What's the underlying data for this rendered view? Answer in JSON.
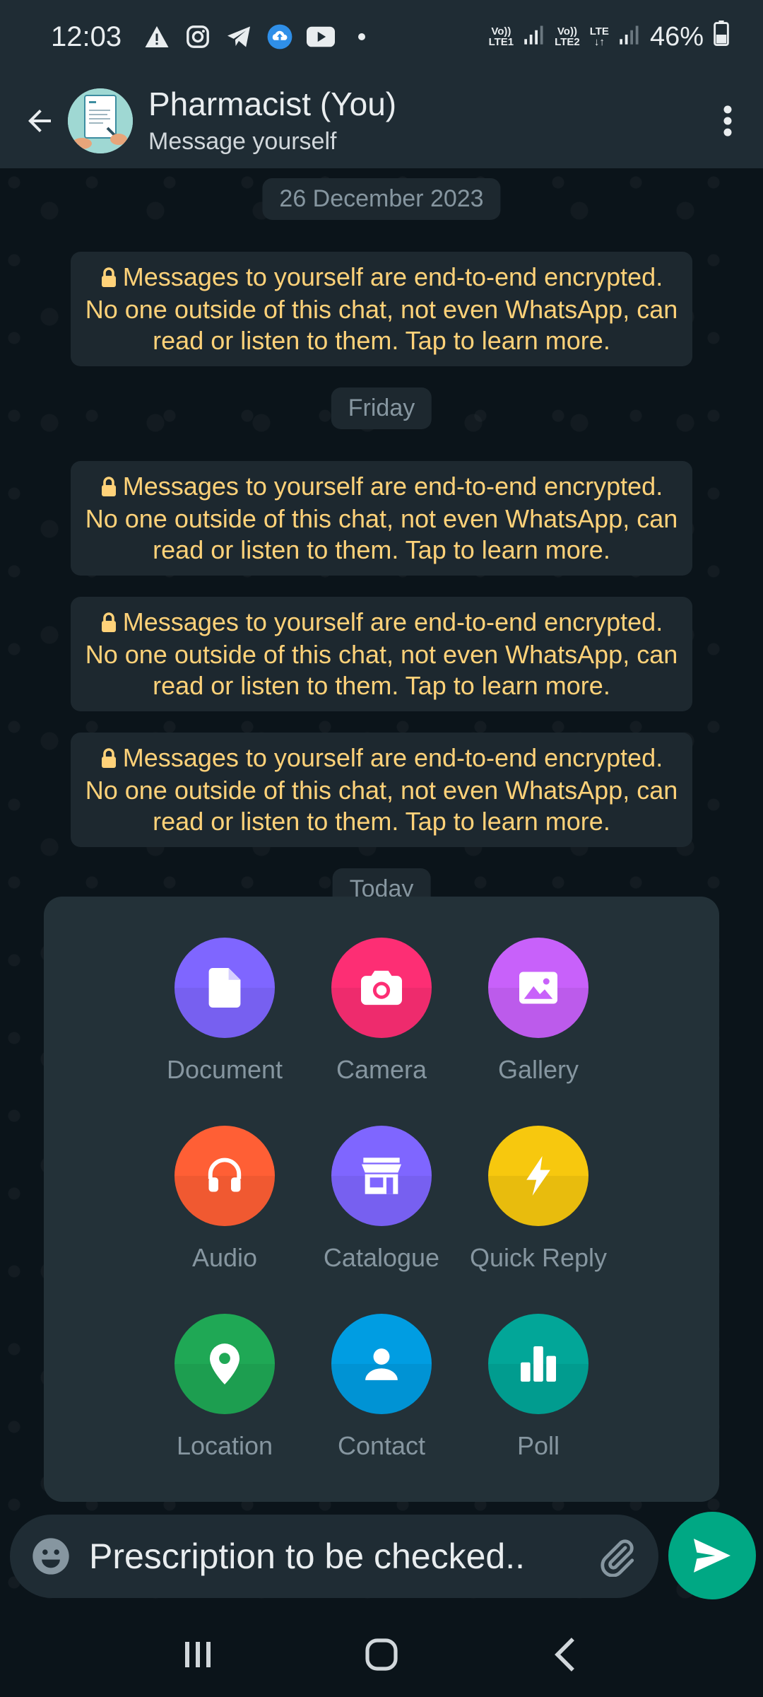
{
  "status_bar": {
    "time": "12:03",
    "sim1_label_top": "Vo))",
    "sim1_label_bottom": "LTE1",
    "sim2_label_top": "Vo))",
    "sim2_label_bottom": "LTE2",
    "lte_label": "LTE",
    "battery": "46%",
    "battery_level": 0.46
  },
  "header": {
    "title": "Pharmacist (You)",
    "subtitle": "Message yourself"
  },
  "chat": {
    "date_chips": [
      "26 December 2023",
      "Friday",
      "Today"
    ],
    "encryption_notice": "Messages to yourself are end-to-end encrypted. No one outside of this chat, not even WhatsApp, can read or listen to them. Tap to learn more."
  },
  "attachments": [
    {
      "label": "Document",
      "icon": "document-icon",
      "color": "#7f66ff"
    },
    {
      "label": "Camera",
      "icon": "camera-icon",
      "color": "#fd2e74"
    },
    {
      "label": "Gallery",
      "icon": "gallery-icon",
      "color": "#c861fa"
    },
    {
      "label": "Audio",
      "icon": "headphones-icon",
      "color": "#ff5f35"
    },
    {
      "label": "Catalogue",
      "icon": "storefront-icon",
      "color": "#7f66ff"
    },
    {
      "label": "Quick Reply",
      "icon": "lightning-icon",
      "color": "#f7c80e"
    },
    {
      "label": "Location",
      "icon": "location-pin-icon",
      "color": "#1fa855"
    },
    {
      "label": "Contact",
      "icon": "person-icon",
      "color": "#009de2"
    },
    {
      "label": "Poll",
      "icon": "bar-chart-icon",
      "color": "#02a698"
    }
  ],
  "composer": {
    "text": "Prescription to be checked..",
    "accent": "#00a884"
  }
}
